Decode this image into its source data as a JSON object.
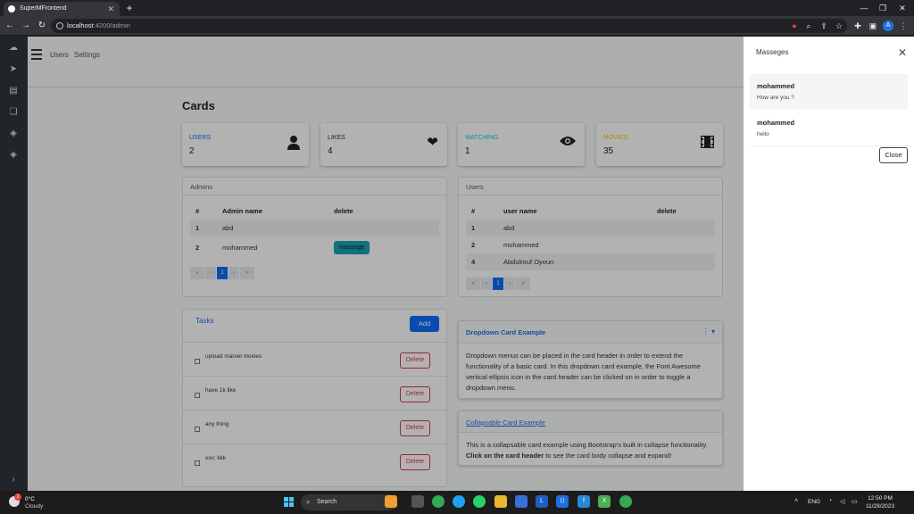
{
  "browser": {
    "tab_title": "SuperMFrontend",
    "url_host": "localhost",
    "url_path": ":4200/admin",
    "profile_initial": "A"
  },
  "nav": {
    "links": [
      "Users",
      "Settings"
    ]
  },
  "page": {
    "title": "Cards"
  },
  "stats": [
    {
      "label": "USERS",
      "value": "2",
      "color": "#0d6efd",
      "icon": "user-icon"
    },
    {
      "label": "LIKES",
      "value": "4",
      "color": "#333333",
      "icon": "heart-icon"
    },
    {
      "label": "WATCHING",
      "value": "1",
      "color": "#0dcaf0",
      "icon": "eye-icon"
    },
    {
      "label": "MOVIES",
      "value": "35",
      "color": "#ffc107",
      "icon": "film-icon"
    }
  ],
  "admins": {
    "title": "Admins",
    "columns": [
      "#",
      "Admin name",
      "delete"
    ],
    "rows": [
      {
        "id": "1",
        "name": "abd",
        "action": ""
      },
      {
        "id": "2",
        "name": "mohammed",
        "action": "massege"
      }
    ],
    "pager": [
      "«",
      "‹",
      "1",
      "›",
      "»"
    ]
  },
  "users": {
    "title": "Users",
    "columns": [
      "#",
      "user name",
      "delete"
    ],
    "rows": [
      {
        "id": "1",
        "name": "abd"
      },
      {
        "id": "2",
        "name": "mohammed"
      },
      {
        "id": "4",
        "name": "Abdulrouf Oyoun"
      }
    ],
    "pager": [
      "«",
      "‹",
      "1",
      "›",
      "»"
    ]
  },
  "tasks": {
    "title": "Tasks",
    "add_label": "Add",
    "delete_label": "Delete",
    "items": [
      "upload marvel movies",
      "have 1k like",
      "any thing",
      "xxx; kkk"
    ]
  },
  "dropdown_card": {
    "title": "Dropdown Card Example",
    "body": "Dropdown menus can be placed in the card header in order to extend the functionality of a basic card. In this dropdown card example, the Font Awesome vertical ellipsis icon in the card header can be clicked on in order to toggle a dropdown menu."
  },
  "collapse_card": {
    "title": "Collapsable Card Example",
    "body_bold": "Click on the card header",
    "body_pre": "This is a collapsable card example using Bootstrap's built in collapse functionality.",
    "body_post": "to see the card body collapse and expand!"
  },
  "messages_panel": {
    "title": "Masseges",
    "close_label": "Close",
    "messages": [
      {
        "from": "mohammed",
        "text": "How are you ?"
      },
      {
        "from": "mohammed",
        "text": "hello"
      }
    ]
  },
  "taskbar": {
    "temp": "0°C",
    "condition": "Cloudy",
    "weather_badge": "1",
    "search_label": "Search",
    "lang": "ENG",
    "time": "12:50 PM",
    "date": "11/28/2023"
  }
}
